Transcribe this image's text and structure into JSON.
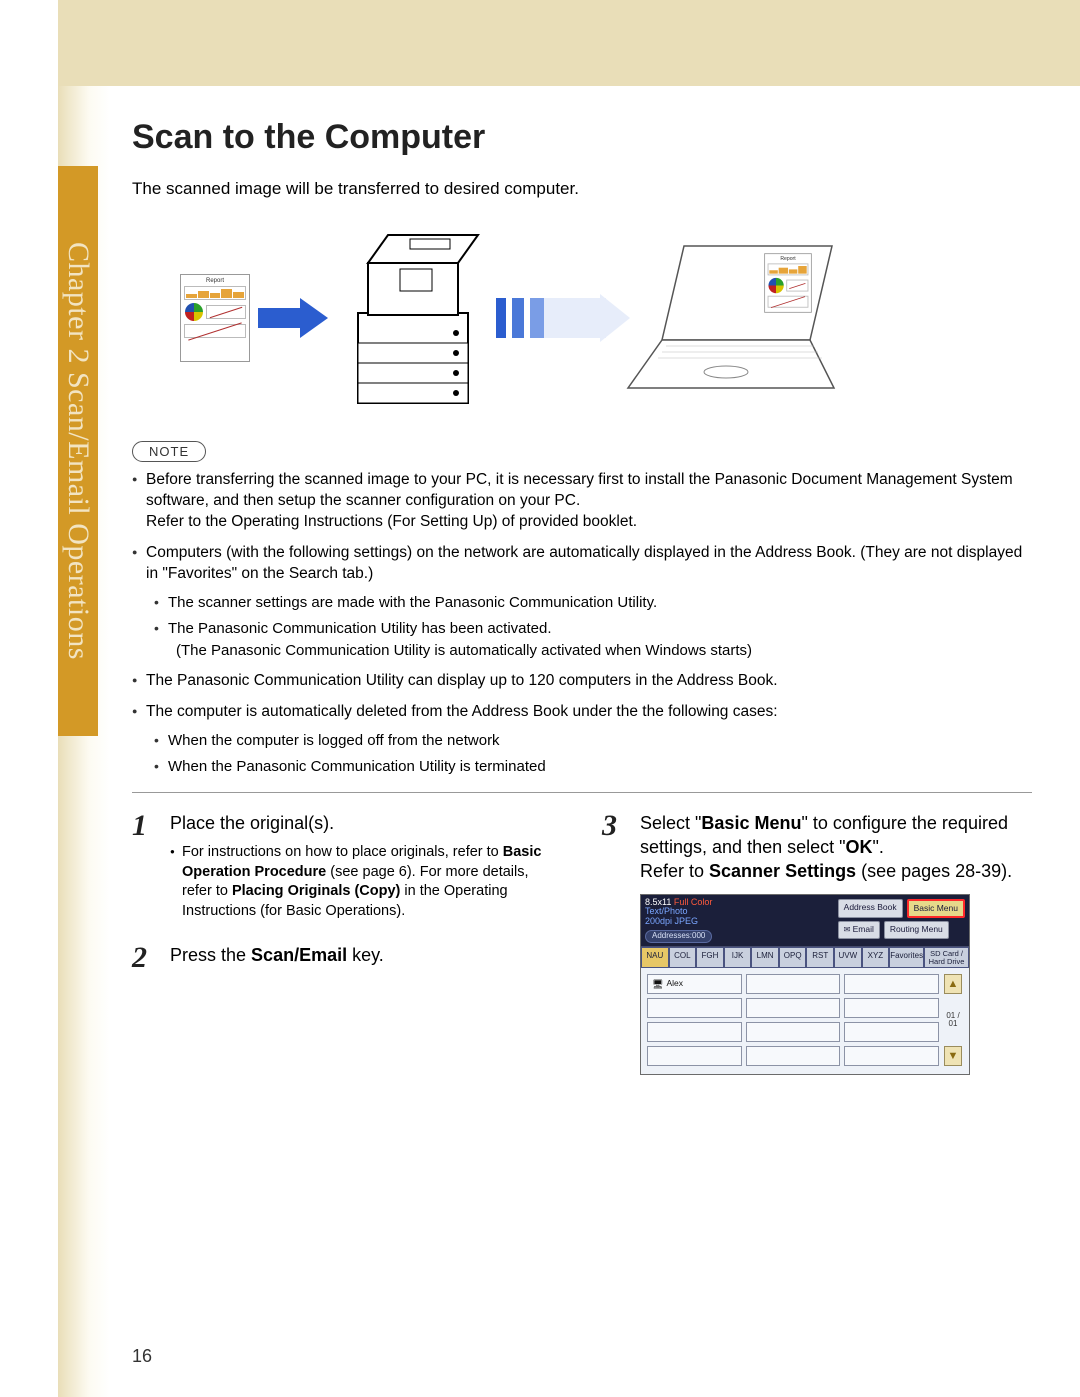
{
  "chapter_tab": "Chapter 2   Scan/Email Operations",
  "title": "Scan to the Computer",
  "intro": "The scanned image will be transferred to desired computer.",
  "report_label": "Report",
  "note_label": "NOTE",
  "notes": {
    "n1": "Before transferring the scanned image to your PC, it is necessary first to install the Panasonic Document Management System software, and then setup the scanner configuration on your PC.",
    "n1b": "Refer to the Operating Instructions (For Setting Up) of provided booklet.",
    "n2": "Computers (with the following settings) on the network are automatically displayed in the Address Book. (They are not displayed in \"Favorites\" on the Search tab.)",
    "n2a": "The scanner settings are made with the Panasonic Communication Utility.",
    "n2b": "The Panasonic Communication Utility has been activated.",
    "n2b_sub": "(The Panasonic Communication Utility is automatically activated when Windows starts)",
    "n3": "The Panasonic Communication Utility can display up to 120 computers in the Address Book.",
    "n4": "The computer is automatically deleted from the Address Book under the the following cases:",
    "n4a": "When the computer is logged off from the network",
    "n4b": "When the Panasonic Communication Utility is terminated"
  },
  "steps": {
    "s1": {
      "num": "1",
      "text": "Place the original(s).",
      "sub_lead": "For instructions on how to place originals, refer to ",
      "sub_b1": "Basic Operation Procedure",
      "sub_mid1": " (see page 6). For more details, refer to ",
      "sub_b2": "Placing Originals (Copy)",
      "sub_tail": " in the Operating Instructions (for Basic Operations)."
    },
    "s2": {
      "num": "2",
      "text_a": "Press the ",
      "text_b": "Scan/Email",
      "text_c": " key."
    },
    "s3": {
      "num": "3",
      "t1": "Select \"",
      "t1b": "Basic Menu",
      "t2": "\" to configure the required settings, and then select \"",
      "t2b": "OK",
      "t3": "\".",
      "t4a": "Refer to ",
      "t4b": "Scanner Settings",
      "t4c": " (see pages 28-39)."
    }
  },
  "screen": {
    "size": "8.5x11",
    "mode1": "Full Color",
    "mode2": "Text/Photo",
    "mode3": "200dpi JPEG",
    "addr_count": "Addresses:000",
    "btn_addrbook": "Address Book",
    "btn_basic": "Basic Menu",
    "btn_email": "Email",
    "btn_routing": "Routing Menu",
    "tabs": [
      "NAU",
      "COL",
      "FGH",
      "IJK",
      "LMN",
      "OPQ",
      "RST",
      "UVW",
      "XYZ",
      "Favorites"
    ],
    "tab_sd": "SD Card / Hard Drive",
    "cell_alex": "Alex",
    "page_indicator": "01 / 01"
  },
  "page_number": "16"
}
